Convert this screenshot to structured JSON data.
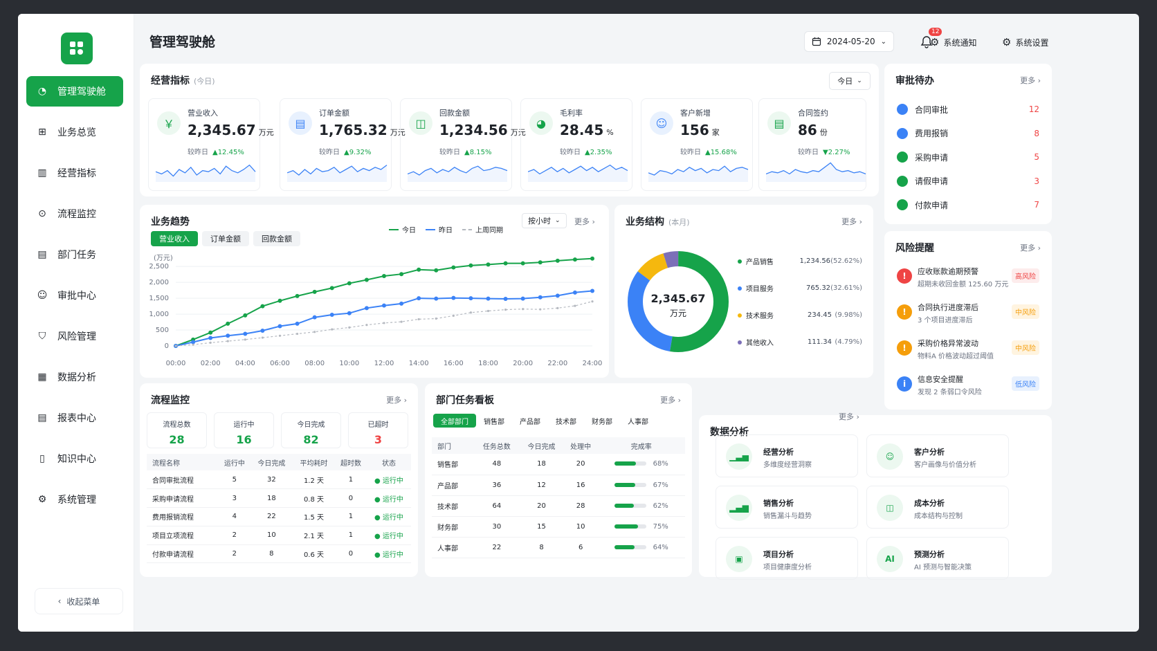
{
  "app": {
    "title": "管理驾驶舱",
    "date": "2024-05-20",
    "bell_count": "12",
    "notify_label": "系统通知",
    "settings_label": "系统设置"
  },
  "sidebar": {
    "items": [
      {
        "label": "管理驾驶舱",
        "icon": "dashboard-icon"
      },
      {
        "label": "业务总览",
        "icon": "overview-icon"
      },
      {
        "label": "经营指标",
        "icon": "metrics-icon"
      },
      {
        "label": "流程监控",
        "icon": "process-icon"
      },
      {
        "label": "部门任务",
        "icon": "task-icon"
      },
      {
        "label": "审批中心",
        "icon": "approval-icon"
      },
      {
        "label": "风险管理",
        "icon": "shield-icon"
      },
      {
        "label": "数据分析",
        "icon": "analysis-icon"
      },
      {
        "label": "报表中心",
        "icon": "report-icon"
      },
      {
        "label": "知识中心",
        "icon": "book-icon"
      },
      {
        "label": "系统管理",
        "icon": "gear-icon"
      }
    ],
    "collapse_label": "收起菜单"
  },
  "kpi": {
    "title": "经营指标",
    "subtitle": "(今日)",
    "range": "今日",
    "items": [
      {
        "label": "营业收入",
        "value": "2,345.67",
        "unit": "万元",
        "cmp": "较昨日",
        "change": "▲12.45%",
        "color": "#16a34a"
      },
      {
        "label": "订单金额",
        "value": "1,765.32",
        "unit": "万元",
        "cmp": "较昨日",
        "change": "▲9.32%",
        "color": "#3b82f6"
      },
      {
        "label": "回款金额",
        "value": "1,234.56",
        "unit": "万元",
        "cmp": "较昨日",
        "change": "▲8.15%",
        "color": "#16a34a"
      },
      {
        "label": "毛利率",
        "value": "28.45",
        "unit": "%",
        "cmp": "较昨日",
        "change": "▲2.35%",
        "color": "#16a34a"
      },
      {
        "label": "客户新增",
        "value": "156",
        "unit": "家",
        "cmp": "较昨日",
        "change": "▲15.68%",
        "color": "#3b82f6"
      },
      {
        "label": "合同签约",
        "value": "86",
        "unit": "份",
        "cmp": "较昨日",
        "change": "▼2.27%",
        "color": "#16a34a"
      }
    ]
  },
  "approval": {
    "title": "审批待办",
    "more": "更多",
    "items": [
      {
        "label": "合同审批",
        "count": "12"
      },
      {
        "label": "费用报销",
        "count": "8"
      },
      {
        "label": "采购申请",
        "count": "5"
      },
      {
        "label": "请假申请",
        "count": "3"
      },
      {
        "label": "付款申请",
        "count": "7"
      }
    ]
  },
  "risk": {
    "title": "风险提醒",
    "more": "更多",
    "items": [
      {
        "title": "应收账款逾期预警",
        "sub": "超期未收回金额 125.60 万元",
        "level": "高风险",
        "color": "#ef4444",
        "bg": "#fdecec"
      },
      {
        "title": "合同执行进度滞后",
        "sub": "3 个项目进度滞后",
        "level": "中风险",
        "color": "#f59e0b",
        "bg": "#fff4e0"
      },
      {
        "title": "采购价格异常波动",
        "sub": "物料A 价格波动超过阈值",
        "level": "中风险",
        "color": "#f59e0b",
        "bg": "#fff4e0"
      },
      {
        "title": "信息安全提醒",
        "sub": "发现 2 条弱口令风险",
        "level": "低风险",
        "color": "#3b82f6",
        "bg": "#e8f1fe"
      }
    ]
  },
  "trend": {
    "title": "业务趋势",
    "tabs": [
      "营业收入",
      "订单金额",
      "回款金额"
    ],
    "granularity": "按小时",
    "more": "更多"
  },
  "chart_data": [
    {
      "type": "line",
      "title": "业务趋势",
      "ylabel": "(万元)",
      "x": [
        "00:00",
        "01:00",
        "02:00",
        "03:00",
        "04:00",
        "05:00",
        "06:00",
        "07:00",
        "08:00",
        "09:00",
        "10:00",
        "11:00",
        "12:00",
        "13:00",
        "14:00",
        "15:00",
        "16:00",
        "17:00",
        "18:00",
        "19:00",
        "20:00",
        "21:00",
        "22:00",
        "23:00",
        "24:00"
      ],
      "xticks": [
        "00:00",
        "02:00",
        "04:00",
        "06:00",
        "08:00",
        "10:00",
        "12:00",
        "14:00",
        "16:00",
        "18:00",
        "20:00",
        "22:00",
        "24:00"
      ],
      "yticks": [
        0,
        500,
        1000,
        1500,
        2000,
        2500
      ],
      "ylim": [
        0,
        2700
      ],
      "legend_position": "top",
      "series": [
        {
          "name": "今日",
          "color": "#16a34a",
          "dash": "",
          "values": [
            0,
            200,
            420,
            700,
            960,
            1250,
            1420,
            1570,
            1700,
            1820,
            1970,
            2080,
            2200,
            2260,
            2400,
            2380,
            2470,
            2530,
            2560,
            2600,
            2600,
            2630,
            2680,
            2720,
            2750
          ]
        },
        {
          "name": "昨日",
          "color": "#3b82f6",
          "dash": "",
          "values": [
            0,
            120,
            250,
            320,
            380,
            480,
            620,
            700,
            900,
            980,
            1030,
            1190,
            1270,
            1330,
            1500,
            1490,
            1510,
            1500,
            1490,
            1480,
            1490,
            1530,
            1580,
            1680,
            1730
          ]
        },
        {
          "name": "上周同期",
          "color": "#b5b9c0",
          "dash": "3,3",
          "values": [
            0,
            40,
            100,
            150,
            200,
            260,
            320,
            380,
            440,
            520,
            580,
            660,
            720,
            760,
            840,
            860,
            950,
            1050,
            1100,
            1140,
            1160,
            1150,
            1190,
            1260,
            1400
          ]
        }
      ]
    },
    {
      "type": "pie",
      "title": "业务结构",
      "subtitle": "(本月)",
      "center_value": "2,345.67",
      "center_unit": "万元",
      "slices": [
        {
          "name": "产品销售",
          "value": "1,234.56",
          "pct": "(52.62%)",
          "share": 52.62,
          "color": "#16a34a"
        },
        {
          "name": "项目服务",
          "value": "765.32",
          "pct": "(32.61%)",
          "share": 32.61,
          "color": "#3b82f6"
        },
        {
          "name": "技术服务",
          "value": "234.45",
          "pct": "(9.98%)",
          "share": 9.98,
          "color": "#f5b80e"
        },
        {
          "name": "其他收入",
          "value": "111.34",
          "pct": "(4.79%)",
          "share": 4.79,
          "color": "#7c6fb8"
        }
      ]
    }
  ],
  "structure": {
    "more": "更多"
  },
  "process": {
    "title": "流程监控",
    "more": "更多",
    "stats": [
      {
        "label": "流程总数",
        "value": "28",
        "color": "#16a34a"
      },
      {
        "label": "运行中",
        "value": "16",
        "color": "#16a34a"
      },
      {
        "label": "今日完成",
        "value": "82",
        "color": "#16a34a"
      },
      {
        "label": "已超时",
        "value": "3",
        "color": "#ef4444"
      }
    ],
    "headers": [
      "流程名称",
      "运行中",
      "今日完成",
      "平均耗时",
      "超时数",
      "状态"
    ],
    "rows": [
      [
        "合同审批流程",
        "5",
        "32",
        "1.2 天",
        "1",
        "运行中"
      ],
      [
        "采购申请流程",
        "3",
        "18",
        "0.8 天",
        "0",
        "运行中"
      ],
      [
        "费用报销流程",
        "4",
        "22",
        "1.5 天",
        "1",
        "运行中"
      ],
      [
        "项目立项流程",
        "2",
        "10",
        "2.1 天",
        "1",
        "运行中"
      ],
      [
        "付款申请流程",
        "2",
        "8",
        "0.6 天",
        "0",
        "运行中"
      ]
    ]
  },
  "dept": {
    "title": "部门任务看板",
    "more": "更多",
    "tabs": [
      "全部部门",
      "销售部",
      "产品部",
      "技术部",
      "财务部",
      "人事部"
    ],
    "headers": [
      "部门",
      "任务总数",
      "今日完成",
      "处理中",
      "完成率"
    ],
    "rows": [
      {
        "name": "销售部",
        "total": "48",
        "done": "18",
        "doing": "20",
        "rate": "68%",
        "r": 0.68
      },
      {
        "name": "产品部",
        "total": "36",
        "done": "12",
        "doing": "16",
        "rate": "67%",
        "r": 0.67
      },
      {
        "name": "技术部",
        "total": "64",
        "done": "20",
        "doing": "28",
        "rate": "62%",
        "r": 0.62
      },
      {
        "name": "财务部",
        "total": "30",
        "done": "15",
        "doing": "10",
        "rate": "75%",
        "r": 0.75
      },
      {
        "name": "人事部",
        "total": "22",
        "done": "8",
        "doing": "6",
        "rate": "64%",
        "r": 0.64
      }
    ]
  },
  "analysis": {
    "title": "数据分析",
    "more": "更多",
    "items": [
      {
        "title": "经营分析",
        "sub": "多维度经营洞察",
        "icon": "bar-chart-icon"
      },
      {
        "title": "客户分析",
        "sub": "客户画像与价值分析",
        "icon": "users-icon"
      },
      {
        "title": "销售分析",
        "sub": "销售漏斗与趋势",
        "icon": "sales-chart-icon"
      },
      {
        "title": "成本分析",
        "sub": "成本结构与控制",
        "icon": "wallet-icon"
      },
      {
        "title": "项目分析",
        "sub": "项目健康度分析",
        "icon": "clipboard-icon"
      },
      {
        "title": "预测分析",
        "sub": "AI 预测与智能决策",
        "icon": "ai-icon"
      }
    ]
  }
}
